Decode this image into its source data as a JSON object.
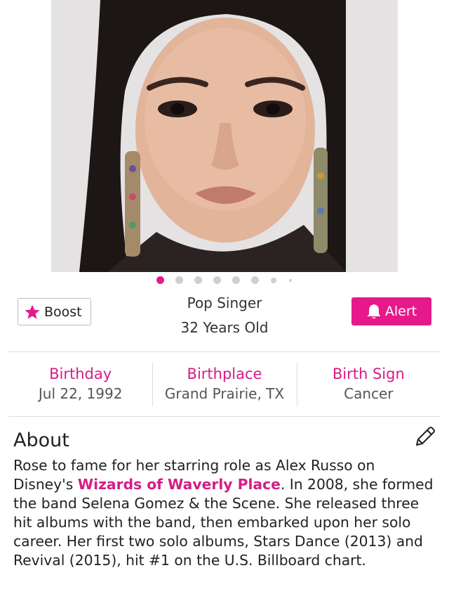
{
  "profile": {
    "occupation": "Pop Singer",
    "age": "32 Years Old"
  },
  "actions": {
    "boost_label": "Boost",
    "alert_label": "Alert"
  },
  "carousel": {
    "total": 8,
    "active_index": 0
  },
  "facts": [
    {
      "label": "Birthday",
      "value": "Jul 22, 1992"
    },
    {
      "label": "Birthplace",
      "value": "Grand Prairie, TX"
    },
    {
      "label": "Birth Sign",
      "value": "Cancer"
    }
  ],
  "about": {
    "title": "About",
    "text_before": "Rose to fame for her starring role as Alex Russo on Disney's ",
    "link_text": "Wizards of Waverly Place",
    "text_after": ". In 2008, she formed the band Selena Gomez & the Scene. She released three hit albums with the band, then embarked upon her solo career. Her first two solo albums, Stars Dance (2013) and Revival (2015), hit #1 on the U.S. Billboard chart."
  },
  "colors": {
    "accent": "#e6198a",
    "label_pink": "#d41d86"
  },
  "icons": {
    "share": "share-icon",
    "star": "star-icon",
    "bell": "bell-icon",
    "edit": "pencil-icon"
  }
}
